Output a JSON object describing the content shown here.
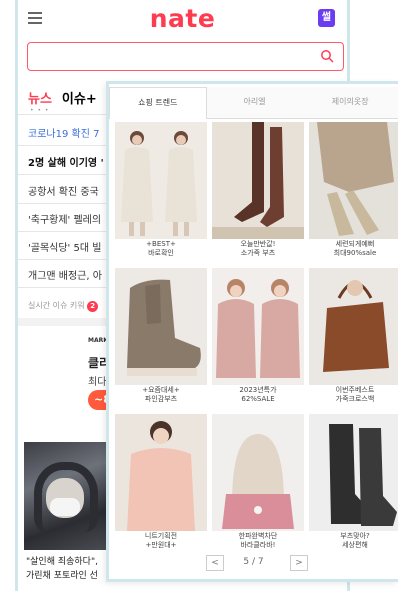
{
  "header": {
    "logo": "nate",
    "badge": "썰"
  },
  "nav": {
    "tab_news": "뉴스",
    "tab_issue": "이슈+",
    "dots": "• • •"
  },
  "news": [
    "코로나19  확진 7",
    "2명 살해 이기영 '",
    "공항서 확진 중국",
    "'축구황제' 펠레의",
    "'골목식당' 5대 빌",
    "개그맨 배정근, 아"
  ],
  "keyword": {
    "label": "실시간 이슈 키워",
    "badge": "2"
  },
  "ad": {
    "brand": "MARKI",
    "title": "클리",
    "sub": "최다",
    "btn": "~8"
  },
  "captions": [
    "\"살인해 죄송하다\",",
    "가린채 포토라인 선"
  ],
  "popup": {
    "tabs": [
      "쇼핑 트렌드",
      "아리엘",
      "제이의옷장"
    ],
    "products": [
      {
        "label1": "+BEST+",
        "label2": "바로확인"
      },
      {
        "label1": "오늘만반값!",
        "label2": "소가죽 부츠"
      },
      {
        "label1": "세련되게예뻐",
        "label2": "최대90%sale"
      },
      {
        "label1": "+요즘대세+",
        "label2": "파인감부츠"
      },
      {
        "label1": "2023년특가",
        "label2": "62%SALE"
      },
      {
        "label1": "이번주베스트",
        "label2": "가죽크로스백"
      },
      {
        "label1": "니트기획전",
        "label2": "+만원대+"
      },
      {
        "label1": "한파완벽차단",
        "label2": "바라클라바!"
      },
      {
        "label1": "부츠맞아?",
        "label2": "세상편해"
      }
    ],
    "pager": {
      "prev": "<",
      "next": ">",
      "page": "5 / 7"
    }
  },
  "colors": {
    "brand": "#ff3b50",
    "frame": "#cfe6ea",
    "badge": "#6a3df0"
  },
  "icons": {
    "menu": "hamburger-icon",
    "search": "search-icon"
  }
}
